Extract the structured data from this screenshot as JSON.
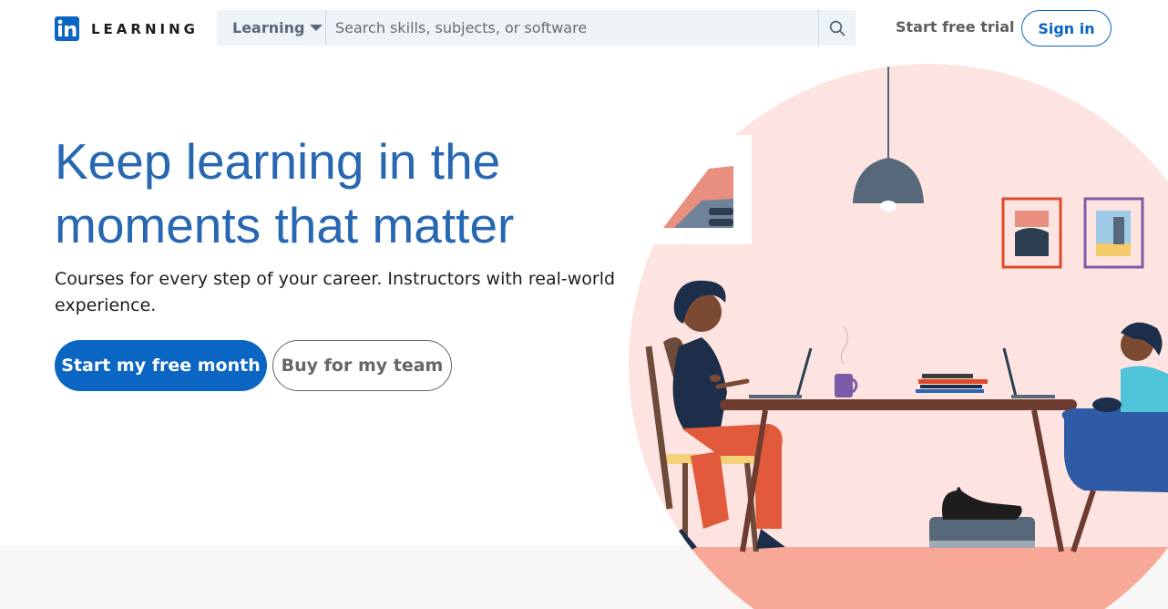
{
  "header": {
    "logo_mark": "in",
    "logo_text": "LEARNING",
    "scope_label": "Learning",
    "search_placeholder": "Search skills, subjects, or software",
    "trial_link": "Start free trial",
    "signin": "Sign in"
  },
  "hero": {
    "title": "Keep learning in the moments that matter",
    "subtitle": "Courses for every step of your career. Instructors with real-world experience.",
    "primary_cta": "Start my free month",
    "secondary_cta": "Buy for my team"
  },
  "colors": {
    "brand": "#0a66c2",
    "title_blue": "#2867b2",
    "illustration_bg": "#fde4e1"
  },
  "icons": [
    "linkedin-logo-icon",
    "chevron-down-icon",
    "search-icon"
  ]
}
